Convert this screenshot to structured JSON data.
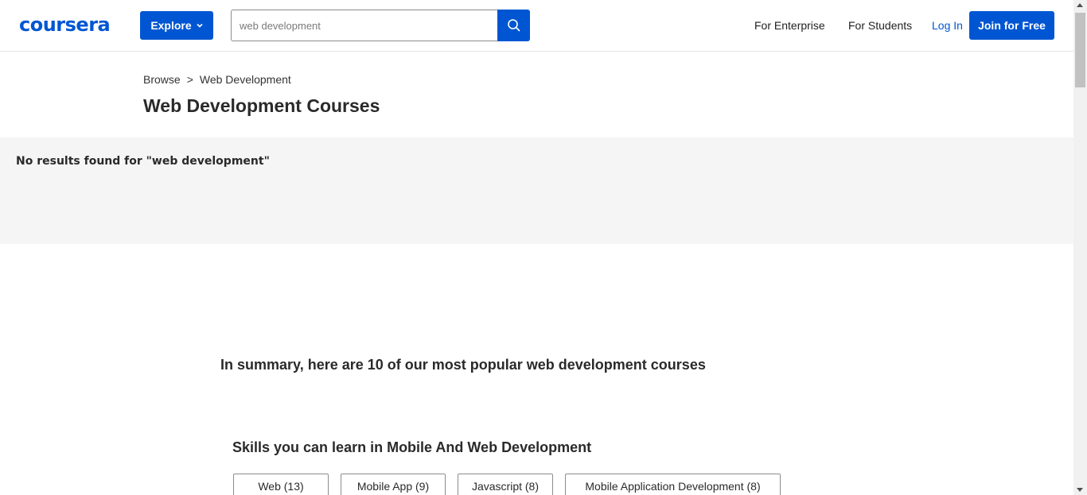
{
  "header": {
    "logo": "coursera",
    "explore_label": "Explore",
    "search": {
      "value": "web development"
    },
    "nav": [
      "For Enterprise",
      "For Students"
    ],
    "login_label": "Log In",
    "join_label": "Join for Free"
  },
  "breadcrumb": {
    "root": "Browse",
    "separator": ">",
    "current": "Web Development"
  },
  "page_title": "Web Development Courses",
  "no_results": "No results found for \"web development\"",
  "summary_heading": "In summary, here are 10 of our most popular web development courses",
  "skills": {
    "heading": "Skills you can learn in Mobile And Web Development",
    "chips": [
      "Web (13)",
      "Mobile App (9)",
      "Javascript (8)",
      "Mobile Application Development (8)"
    ]
  },
  "colors": {
    "brand": "#0056d2",
    "band_bg": "#f5f5f5"
  },
  "icons": {
    "search": "search-icon",
    "explore_chevron": "chevron-down-icon"
  }
}
